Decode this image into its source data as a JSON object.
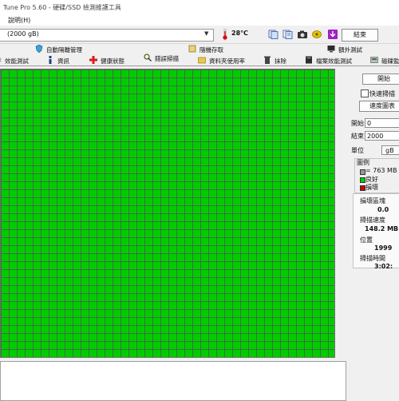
{
  "window": {
    "title": "Tune Pro 5.60 - 硬碟/SSD 檢測維護工具"
  },
  "menu": {
    "help": "說明(H)"
  },
  "toolbar": {
    "drive": "(2000 gB)",
    "temperature": "28℃",
    "exit_label": "結束"
  },
  "tabs_row1": [
    {
      "label": "自動隔離管理",
      "icon": "shield-icon"
    },
    {
      "label": "隨機存取",
      "icon": "cube-icon"
    },
    {
      "label": "額外測試",
      "icon": "monitor-icon"
    }
  ],
  "tabs_row2": [
    {
      "label": "效能測試",
      "icon": "gauge-icon"
    },
    {
      "label": "資訊",
      "icon": "info-icon"
    },
    {
      "label": "健康狀態",
      "icon": "health-icon"
    },
    {
      "label": "錯誤掃描",
      "icon": "magnifier-icon"
    },
    {
      "label": "資料夾使用率",
      "icon": "folder-icon"
    },
    {
      "label": "抹除",
      "icon": "trash-icon"
    },
    {
      "label": "檔案效能測試",
      "icon": "file-icon"
    },
    {
      "label": "磁碟監",
      "icon": "disk-icon"
    }
  ],
  "scan": {
    "start_button": "開始",
    "quick_scan": "快速掃描",
    "speed_map_button": "速度圖表",
    "start_label": "開始",
    "start_value": "0",
    "end_label": "結束",
    "end_value": "2000",
    "unit_label": "單位",
    "unit_value": "gB"
  },
  "legend": {
    "title": "圖例",
    "block_size": "= 763 MB",
    "good": "良好",
    "bad": "損壞"
  },
  "stats": {
    "damaged_blocks_label": "損壞區塊",
    "damaged_blocks_value": "0.0",
    "scan_speed_label": "掃描速度",
    "scan_speed_value": "148.2 MB",
    "position_label": "位置",
    "position_value": "1999",
    "scan_time_label": "掃描時間",
    "scan_time_value": "3:02:"
  },
  "colors": {
    "block_good": "#00cc00",
    "block_bad": "#cc0000",
    "grid_line": "#555555"
  }
}
